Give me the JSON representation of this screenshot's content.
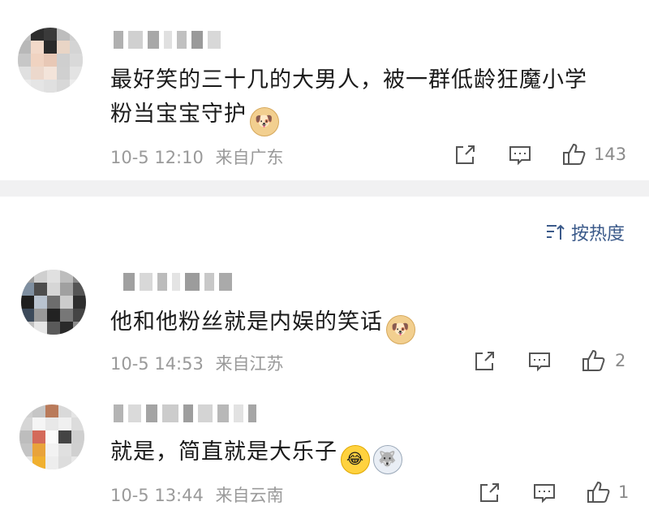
{
  "comments": [
    {
      "text_line1": "最好笑的三十几的大男人，被一群低龄狂魔小学",
      "text_line2": "粉当宝宝守护",
      "date": "10-5 12:10",
      "location": "来自广东",
      "likes": "143",
      "emojis": [
        "doge-emoji"
      ]
    },
    {
      "text_line1": "他和他粉丝就是内娱的笑话",
      "date": "10-5 14:53",
      "location": "来自江苏",
      "likes": "2",
      "emojis": [
        "doge-emoji"
      ]
    },
    {
      "text_line1": "就是，简直就是大乐子",
      "date": "10-5 13:44",
      "location": "来自云南",
      "likes": "1",
      "emojis": [
        "laugh-cry-emoji",
        "husky-emoji"
      ]
    }
  ],
  "sort": {
    "label": "按热度"
  },
  "icons": {
    "share": "share-icon",
    "comment": "comment-icon",
    "like": "thumbs-up-icon",
    "sort": "sort-icon"
  },
  "colors": {
    "accent": "#3b5a8a",
    "meta": "#9a9a9a",
    "divider": "#f1f1f2"
  }
}
